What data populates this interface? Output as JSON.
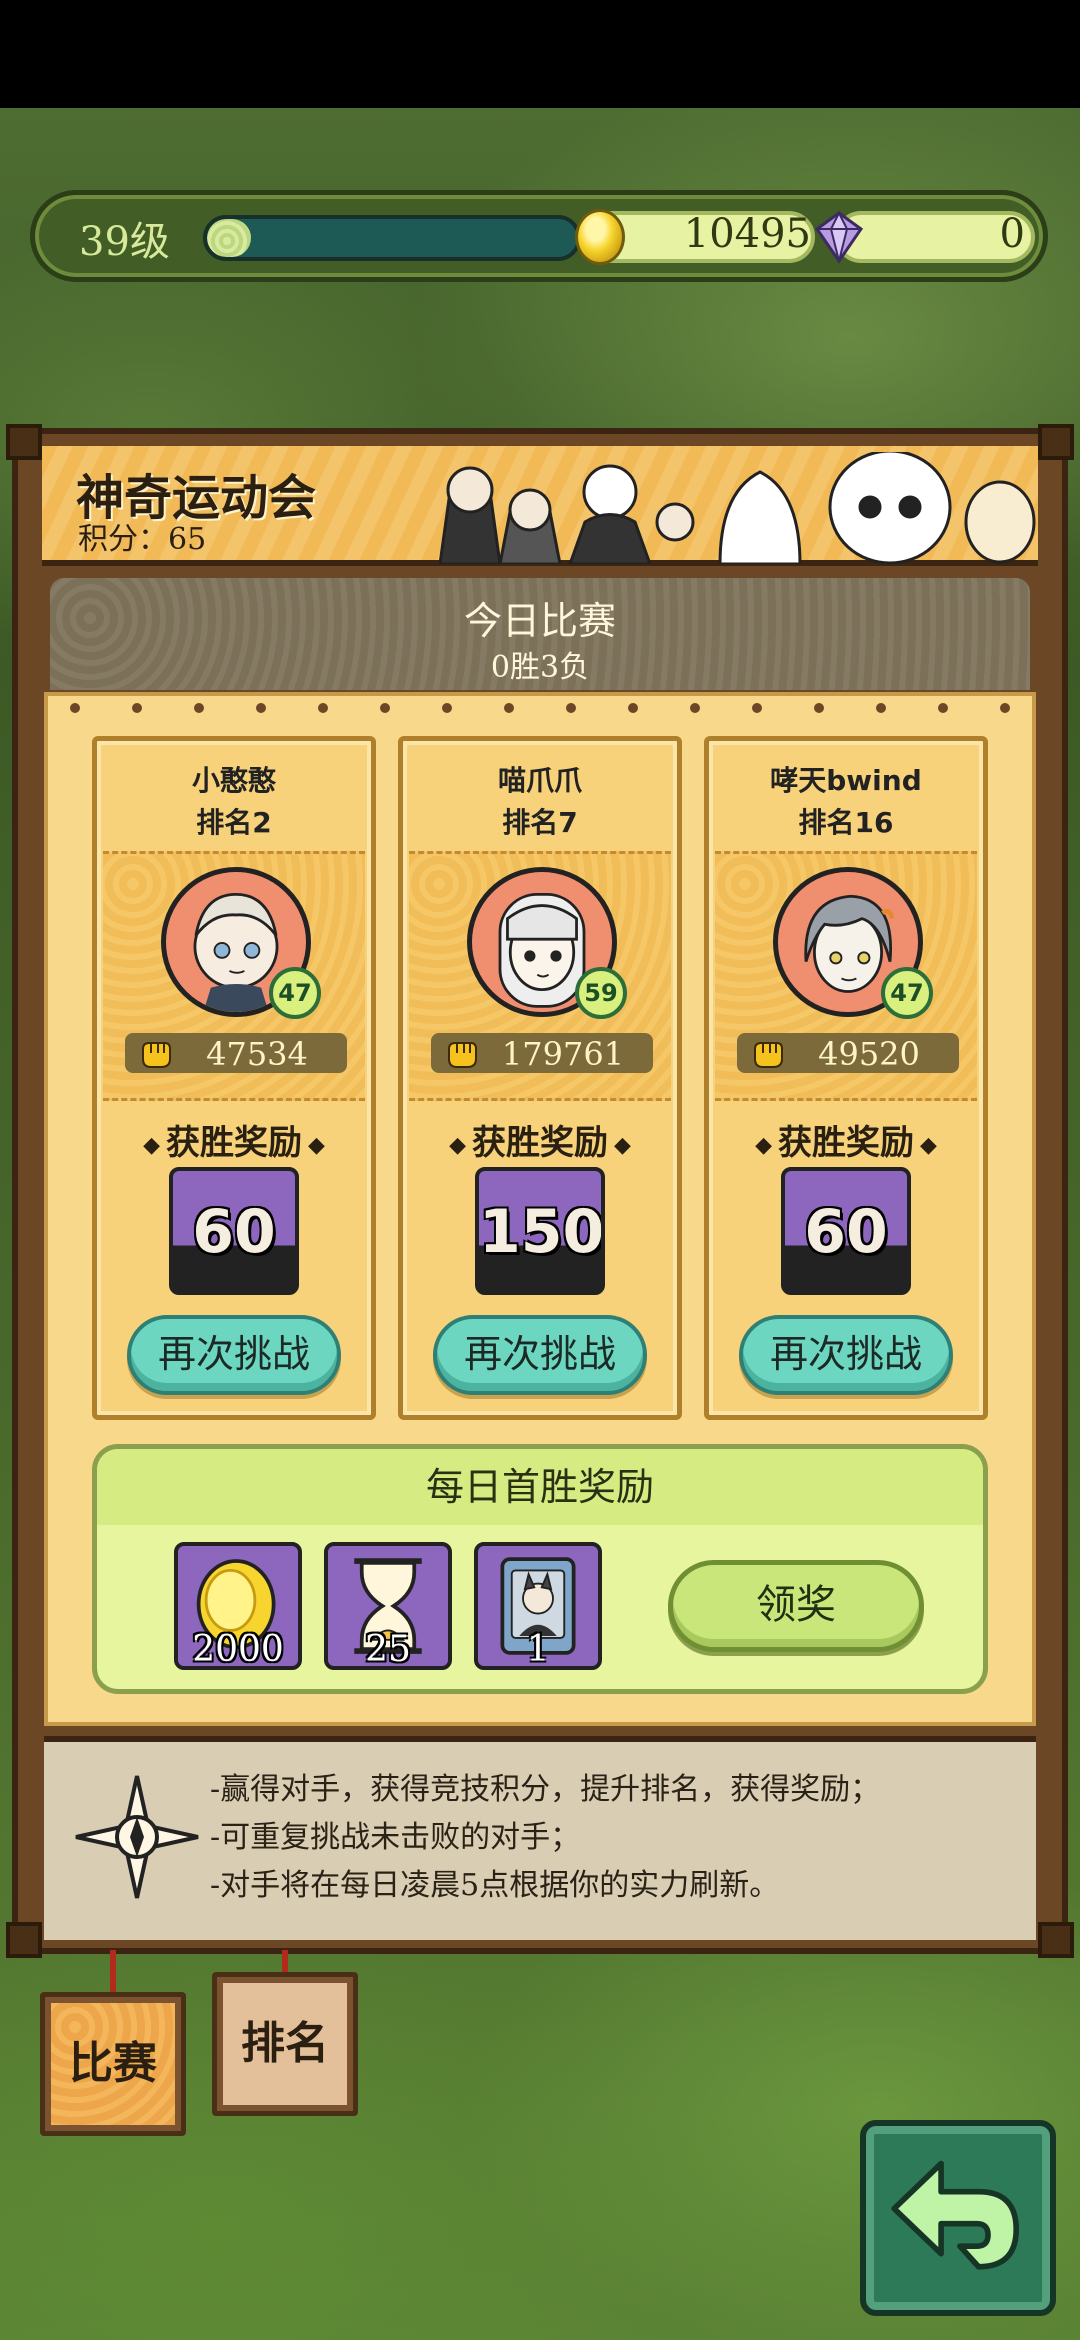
{
  "hud": {
    "level": "39级",
    "exp_fraction": 0.12,
    "coins": "10495",
    "gems": "0"
  },
  "event": {
    "title": "神奇运动会",
    "score_label": "积分：65"
  },
  "today": {
    "title": "今日比赛",
    "record": "0胜3负"
  },
  "opponents": [
    {
      "name": "小憨憨",
      "rank": "排名2",
      "level": "47",
      "power": "47534",
      "reward_label": "获胜奖励",
      "reward": "60",
      "button": "再次挑战"
    },
    {
      "name": "喵爪爪",
      "rank": "排名7",
      "level": "59",
      "power": "179761",
      "reward_label": "获胜奖励",
      "reward": "150",
      "button": "再次挑战"
    },
    {
      "name": "哮天bwind",
      "rank": "排名16",
      "level": "47",
      "power": "49520",
      "reward_label": "获胜奖励",
      "reward": "60",
      "button": "再次挑战"
    }
  ],
  "daily": {
    "title": "每日首胜奖励",
    "items": [
      {
        "icon": "gold-coin-icon",
        "count": "2000"
      },
      {
        "icon": "hourglass-icon",
        "count": "25"
      },
      {
        "icon": "character-card-icon",
        "count": "1"
      }
    ],
    "claim_button": "领奖"
  },
  "rules": [
    "-赢得对手，获得竞技积分，提升排名，获得奖励；",
    "-可重复挑战未击败的对手；",
    "-对手将在每日凌晨5点根据你的实力刷新。"
  ],
  "tabs": {
    "match": "比赛",
    "ranking": "排名"
  },
  "colors": {
    "panel_wood": "#6b4726",
    "card_yellow": "#f7d27a",
    "button_teal": "#6cd6c1",
    "reward_purple": "#8d67bd"
  }
}
